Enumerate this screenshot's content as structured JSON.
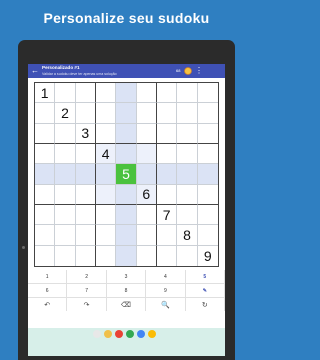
{
  "headline": "Personalize seu sudoku",
  "appbar": {
    "title": "Personalizado #1",
    "subtitle": "Validar a sudoku deve ter apenas uma solução",
    "badge": "68",
    "back_icon": "arrow-left-icon",
    "menu_icon": "more-vert-icon"
  },
  "board": {
    "selected": {
      "row": 4,
      "col": 4
    },
    "cells": [
      {
        "row": 0,
        "col": 0,
        "value": "1"
      },
      {
        "row": 1,
        "col": 1,
        "value": "2"
      },
      {
        "row": 2,
        "col": 2,
        "value": "3"
      },
      {
        "row": 3,
        "col": 3,
        "value": "4"
      },
      {
        "row": 4,
        "col": 4,
        "value": "5"
      },
      {
        "row": 5,
        "col": 5,
        "value": "6"
      },
      {
        "row": 6,
        "col": 6,
        "value": "7"
      },
      {
        "row": 7,
        "col": 7,
        "value": "8"
      },
      {
        "row": 8,
        "col": 8,
        "value": "9"
      }
    ]
  },
  "keypad": {
    "row1": [
      "1",
      "2",
      "3",
      "4",
      "5"
    ],
    "row2": [
      "6",
      "7",
      "8",
      "9",
      "✎"
    ],
    "tools": [
      "↶",
      "↷",
      "⌫",
      "🔍",
      "↻"
    ]
  },
  "colors": {
    "background": "#2f7fc1",
    "appbar": "#3f51b5",
    "selected_cell": "#4ac23e",
    "highlight": "#dbe3f5"
  }
}
